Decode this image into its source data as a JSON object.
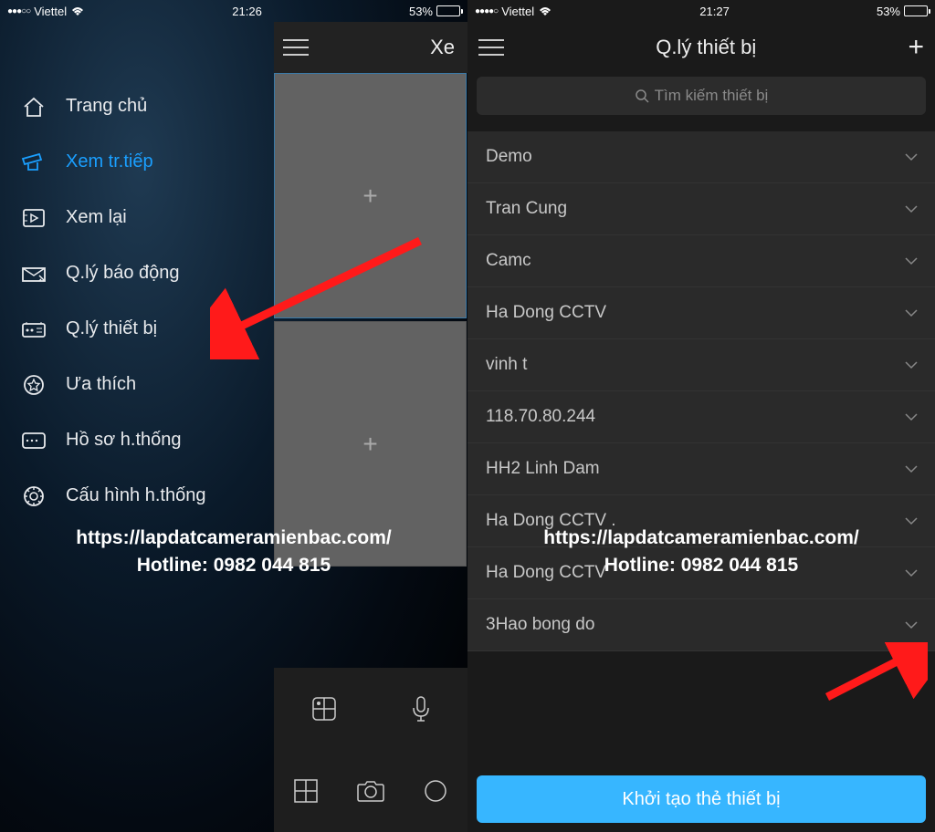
{
  "left": {
    "status": {
      "carrier": "Viettel",
      "time": "21:26",
      "battery": "53%",
      "level": 53
    },
    "header_title_partial": "Xe",
    "sidebar_items": [
      {
        "icon": "home-icon",
        "label": "Trang chủ",
        "active": false
      },
      {
        "icon": "camera-icon",
        "label": "Xem tr.tiếp",
        "active": true
      },
      {
        "icon": "playback-icon",
        "label": "Xem lại",
        "active": false
      },
      {
        "icon": "alarm-icon",
        "label": "Q.lý báo động",
        "active": false
      },
      {
        "icon": "device-icon",
        "label": "Q.lý thiết bị",
        "active": false
      },
      {
        "icon": "favorite-icon",
        "label": "Ưa thích",
        "active": false
      },
      {
        "icon": "profile-icon",
        "label": "Hồ sơ h.thống",
        "active": false
      },
      {
        "icon": "settings-icon",
        "label": "Cấu hình h.thống",
        "active": false
      }
    ],
    "watermark_url": "https://lapdatcameramienbac.com/",
    "watermark_hotline": "Hotline: 0982 044 815"
  },
  "right": {
    "status": {
      "carrier": "Viettel",
      "time": "21:27",
      "battery": "53%",
      "level": 53
    },
    "header_title": "Q.lý thiết bị",
    "search_placeholder": "Tìm kiếm thiết bị",
    "devices": [
      "Demo",
      "Tran Cung",
      "Camc",
      "Ha Dong CCTV",
      "vinh t",
      "118.70.80.244",
      "HH2 Linh Dam",
      "Ha Dong CCTV .",
      "Ha Dong CCTV",
      "3Hao bong do"
    ],
    "bottom_button": "Khởi tạo thẻ thiết bị",
    "watermark_url": "https://lapdatcameramienbac.com/",
    "watermark_hotline": "Hotline: 0982 044 815"
  },
  "colors": {
    "accent": "#1a9fff",
    "button": "#37b6ff"
  }
}
